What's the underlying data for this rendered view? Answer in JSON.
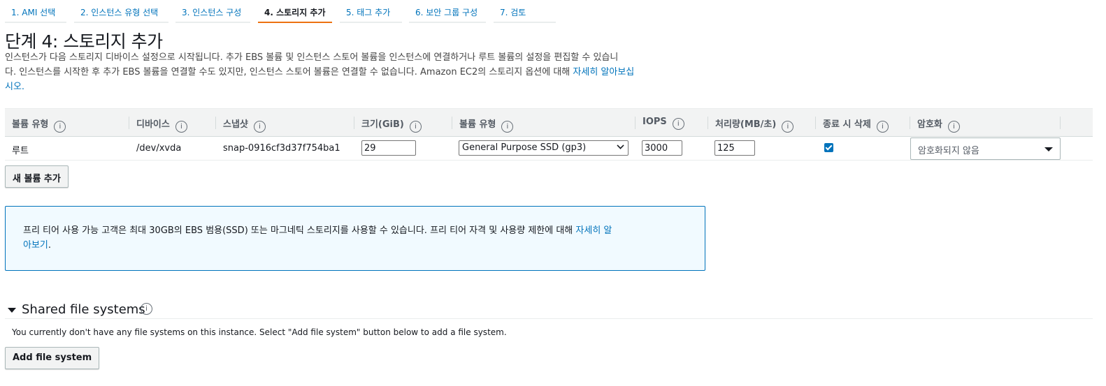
{
  "tabs": [
    {
      "label": "1. AMI 선택"
    },
    {
      "label": "2. 인스턴스 유형 선택"
    },
    {
      "label": "3. 인스턴스 구성"
    },
    {
      "label": "4. 스토리지 추가"
    },
    {
      "label": "5. 태그 추가"
    },
    {
      "label": "6. 보안 그룹 구성"
    },
    {
      "label": "7. 검토"
    }
  ],
  "active_tab": "4. 스토리지 추가",
  "header": {
    "title": "단계 4: 스토리지 추가",
    "description_line1": "인스턴스가 다음 스토리지 디바이스 설정으로 시작됩니다. 추가 EBS 볼륨 및 인스턴스 스토어 볼륨을 인스턴스에 연결하거나 루트 볼륨의 설정을 편집할 수 있습니",
    "description_line2": "다. 인스턴스를 시작한 후 추가 EBS 볼륨을 연결할 수도 있지만, 인스턴스 스토어 볼륨은 연결할 수 없습니다. Amazon EC2의 스토리지 옵션에 대해 ",
    "description_link": "자세히 알아보십",
    "description_line3": "시오."
  },
  "table": {
    "columns": [
      "볼륨 유형",
      "디바이스",
      "스냅샷",
      "크기(GiB)",
      "볼륨 유형",
      "IOPS",
      "처리량(MB/초)",
      "종료 시 삭제",
      "암호화"
    ],
    "info_glyph": "i",
    "row": {
      "volume_type": "루트",
      "device": "/dev/xvda",
      "snapshot": "snap-0916cf3d37f754ba1",
      "size": "29",
      "ebs_volume_type": "General Purpose SSD (gp3)",
      "iops": "3000",
      "throughput": "125",
      "delete_on_termination": true,
      "encryption": "암호화되지 않음"
    }
  },
  "add_volume_button": "새 볼륨 추가",
  "info_box": {
    "text": "프리 티어 사용 가능 고객은 최대 30GB의 EBS 범용(SSD) 또는 마그네틱 스토리지를 사용할 수 있습니다. 프리 티어 자격 및 사용량 제한에 대해 ",
    "link_part1": "자세히 알",
    "link_part2": "아보기",
    "tail": "."
  },
  "shared_fs": {
    "title": "Shared file systems",
    "description": "You currently don't have any file systems on this instance. Select \"Add file system\" button below to add a file system.",
    "add_button": "Add file system"
  },
  "colors": {
    "accent": "#ec7211",
    "link": "#0073bb",
    "info_bg": "#f1faff"
  }
}
